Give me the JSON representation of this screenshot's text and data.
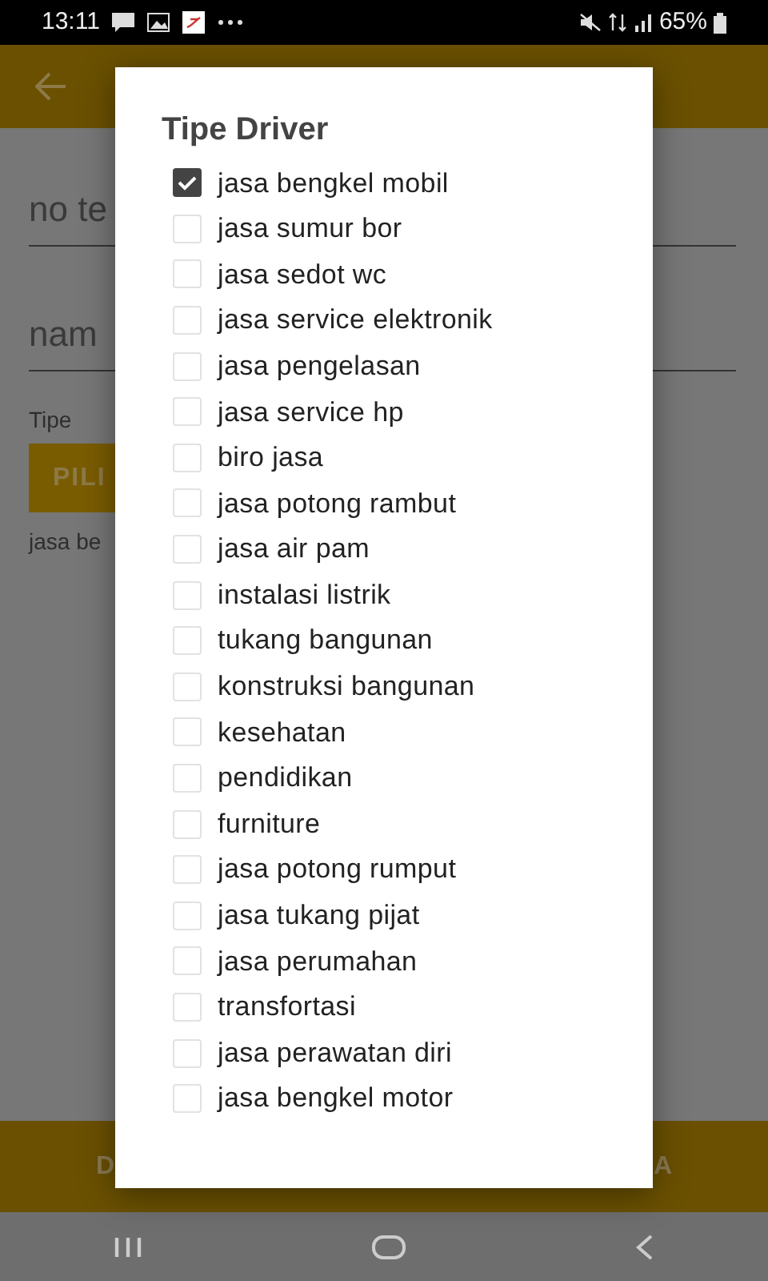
{
  "status_bar": {
    "time": "13:11",
    "battery": "65%"
  },
  "form": {
    "fields": [
      {
        "placeholder": "no te"
      },
      {
        "placeholder": "nam"
      }
    ],
    "type_label": "Tipe",
    "pick_button": "PILI",
    "selected_type": "jasa be"
  },
  "bottom_bar": {
    "left_button": "D",
    "right_button": "A"
  },
  "dialog": {
    "title": "Tipe Driver",
    "options": [
      {
        "label": "jasa bengkel mobil",
        "checked": true
      },
      {
        "label": "jasa sumur bor",
        "checked": false
      },
      {
        "label": "jasa sedot wc",
        "checked": false
      },
      {
        "label": "jasa service elektronik",
        "checked": false
      },
      {
        "label": "jasa pengelasan",
        "checked": false
      },
      {
        "label": "jasa service hp",
        "checked": false
      },
      {
        "label": "biro jasa",
        "checked": false
      },
      {
        "label": "jasa potong rambut",
        "checked": false
      },
      {
        "label": "jasa air pam",
        "checked": false
      },
      {
        "label": "instalasi listrik",
        "checked": false
      },
      {
        "label": "tukang bangunan",
        "checked": false
      },
      {
        "label": "konstruksi bangunan",
        "checked": false
      },
      {
        "label": "kesehatan",
        "checked": false
      },
      {
        "label": "pendidikan",
        "checked": false
      },
      {
        "label": "furniture",
        "checked": false
      },
      {
        "label": "jasa potong rumput",
        "checked": false
      },
      {
        "label": "jasa tukang pijat",
        "checked": false
      },
      {
        "label": "jasa perumahan",
        "checked": false
      },
      {
        "label": "transfortasi",
        "checked": false
      },
      {
        "label": "jasa perawatan diri",
        "checked": false
      },
      {
        "label": "jasa bengkel motor",
        "checked": false
      }
    ]
  }
}
